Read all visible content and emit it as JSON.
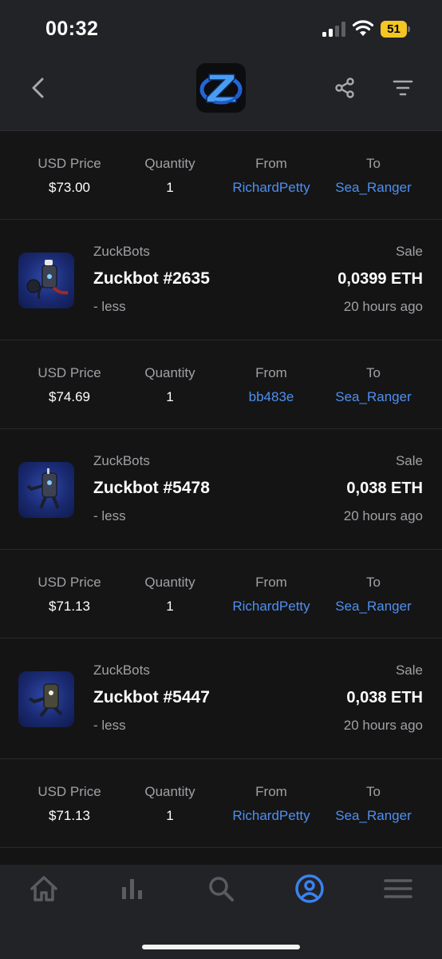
{
  "status_bar": {
    "time": "00:32",
    "battery_level": "51",
    "icons": [
      "cellular-signal-icon",
      "wifi-icon",
      "battery-icon"
    ]
  },
  "nav": {
    "icons": [
      "back-chevron-icon",
      "app-logo",
      "share-icon",
      "filter-icon"
    ]
  },
  "column_headers": {
    "usd_price": "USD Price",
    "quantity": "Quantity",
    "from": "From",
    "to": "To"
  },
  "top_detail": {
    "usd_price": "$73.00",
    "quantity": "1",
    "from": "RichardPetty",
    "to": "Sea_Ranger"
  },
  "activities": [
    {
      "collection": "ZuckBots",
      "name": "Zuckbot #2635",
      "less": "- less",
      "event": "Sale",
      "price": "0,0399 ETH",
      "time": "20 hours ago",
      "usd_price": "$74.69",
      "quantity": "1",
      "from": "bb483e",
      "to": "Sea_Ranger"
    },
    {
      "collection": "ZuckBots",
      "name": "Zuckbot #5478",
      "less": "- less",
      "event": "Sale",
      "price": "0,038 ETH",
      "time": "20 hours ago",
      "usd_price": "$71.13",
      "quantity": "1",
      "from": "RichardPetty",
      "to": "Sea_Ranger"
    },
    {
      "collection": "ZuckBots",
      "name": "Zuckbot #5447",
      "less": "- less",
      "event": "Sale",
      "price": "0,038 ETH",
      "time": "20 hours ago",
      "usd_price": "$71.13",
      "quantity": "1",
      "from": "RichardPetty",
      "to": "Sea_Ranger"
    }
  ],
  "tab_bar": {
    "tabs": [
      "home-icon",
      "stats-icon",
      "search-icon",
      "profile-icon",
      "menu-icon"
    ],
    "active": "profile-icon"
  },
  "colors": {
    "background": "#141414",
    "bar_background": "#222326",
    "link": "#4f8ff0",
    "active_tab": "#3b82f0",
    "inactive_tab": "#5a5c63",
    "battery": "#f3c623"
  }
}
